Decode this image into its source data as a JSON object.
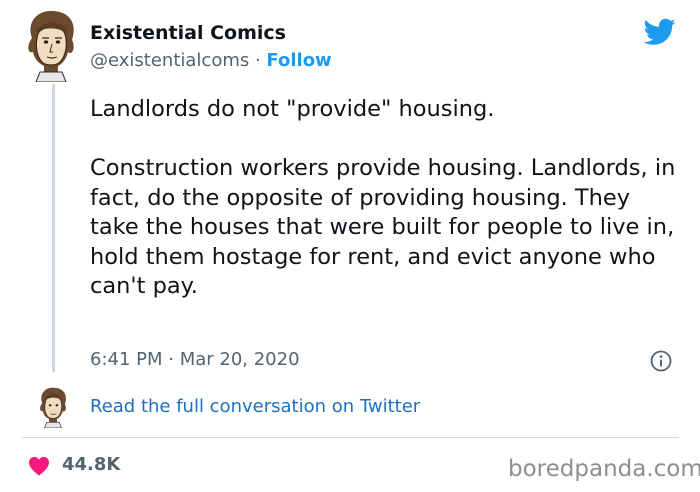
{
  "author": {
    "name": "Existential Comics",
    "handle": "@existentialcoms",
    "separator": " · ",
    "follow_label": "Follow"
  },
  "tweet": {
    "text": "Landlords do not \"provide\" housing.\n\nConstruction workers provide housing. Landlords, in fact, do the opposite of providing housing. They take the houses that were built for people to live in, hold them hostage for rent, and evict anyone who can't pay.",
    "timestamp": "6:41 PM · Mar 20, 2020"
  },
  "conversation_link": "Read the full conversation on Twitter",
  "likes": "44.8K",
  "watermark": "boredpanda.com",
  "icons": {
    "brand": "twitter-bird-icon",
    "info": "info-icon",
    "like": "heart-icon"
  },
  "colors": {
    "link_blue": "#1d9bf0",
    "heart_red": "#f91880",
    "muted_text": "#536471"
  }
}
